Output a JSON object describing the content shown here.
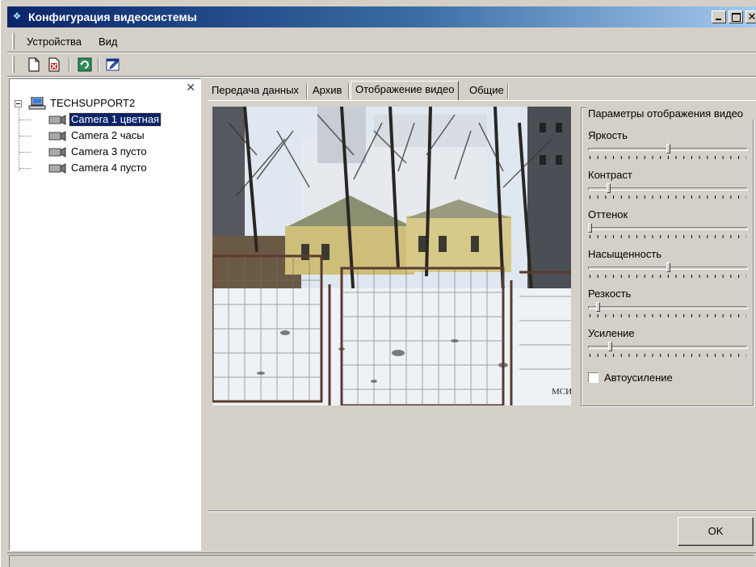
{
  "window": {
    "title": "Конфигурация видеосистемы",
    "close_glyph": "✕"
  },
  "menu": {
    "items": [
      "Устройства",
      "Вид"
    ]
  },
  "toolbar": {
    "icons": [
      "new-document-icon",
      "delete-icon",
      "refresh-icon",
      "edit-icon"
    ]
  },
  "tree": {
    "pane_close": "✕",
    "root": "TECHSUPPORT2",
    "cameras": [
      "Camera 1 цветная",
      "Camera 2 часы",
      "Camera 3 пусто",
      "Camera 4 пусто"
    ],
    "selected_index": 0
  },
  "tabs": {
    "items": [
      "Передача данных",
      "Архив",
      "Отображение видео",
      "Общие"
    ],
    "active_index": 2
  },
  "video": {
    "watermark": "МСИ"
  },
  "params": {
    "group_title": "Параметры отображения видео",
    "sliders": [
      {
        "label": "Яркость",
        "level": 0.5
      },
      {
        "label": "Контраст",
        "level": 0.12
      },
      {
        "label": "Оттенок",
        "level": 0.0
      },
      {
        "label": "Насыщенность",
        "level": 0.5
      },
      {
        "label": "Резкость",
        "level": 0.05
      },
      {
        "label": "Усиление",
        "level": 0.13
      }
    ],
    "autogain_label": "Автоусиление",
    "autogain_checked": false
  },
  "buttons": {
    "ok": "OK"
  },
  "colors": {
    "title_gradient_start": "#0a246a",
    "title_gradient_end": "#a6caf0",
    "selection": "#0a246a",
    "face": "#d4d0c8"
  }
}
